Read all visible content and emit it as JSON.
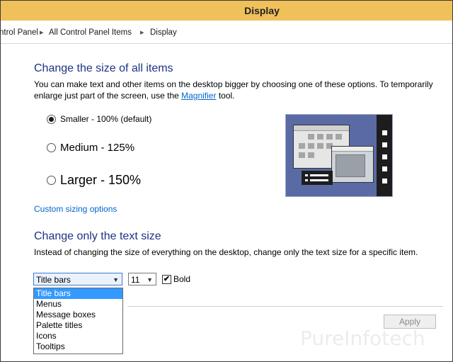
{
  "window": {
    "title": "Display"
  },
  "breadcrumb": {
    "items": [
      "Control Panel",
      "All Control Panel Items",
      "Display"
    ],
    "visible_prefix": "ntrol Panel"
  },
  "scale_section": {
    "heading": "Change the size of all items",
    "desc_line1": "You can make text and other items on the desktop bigger by choosing one of these options. To temporarily",
    "desc_line2_pre": "enlarge just part of the screen, use the ",
    "desc_link": "Magnifier",
    "desc_line2_post": " tool.",
    "options": [
      {
        "label": "Smaller - 100% (default)",
        "checked": true
      },
      {
        "label": "Medium - 125%",
        "checked": false
      },
      {
        "label": "Larger - 150%",
        "checked": false
      }
    ],
    "custom_link": "Custom sizing options"
  },
  "text_section": {
    "heading": "Change only the text size",
    "desc": "Instead of changing the size of everything on the desktop, change only the text size for a specific item.",
    "item_select_value": "Title bars",
    "size_select_value": "11",
    "bold_label": "Bold",
    "bold_checked": true,
    "dropdown_options": [
      "Title bars",
      "Menus",
      "Message boxes",
      "Palette titles",
      "Icons",
      "Tooltips"
    ],
    "selected_option_index": 0
  },
  "buttons": {
    "apply": "Apply"
  },
  "watermark": "PureInfotech",
  "colors": {
    "heading": "#1e3287",
    "link": "#0066cc",
    "titlebar": "#f0c05a",
    "selection": "#3399ff"
  },
  "icons": {
    "preview": "display-preview-illustration",
    "checkmark": "✔",
    "arrow": "chevron-down-icon"
  }
}
